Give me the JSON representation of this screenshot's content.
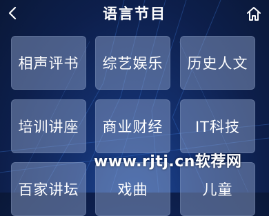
{
  "header": {
    "title": "语言节目",
    "back_icon": "chevron-left-icon",
    "home_icon": "home-icon"
  },
  "tiles": [
    {
      "label": "相声评书"
    },
    {
      "label": "综艺娱乐"
    },
    {
      "label": "历史人文"
    },
    {
      "label": "培训讲座"
    },
    {
      "label": "商业财经"
    },
    {
      "label": "IT科技"
    },
    {
      "label": "百家讲坛"
    },
    {
      "label": "戏曲"
    },
    {
      "label": "儿童"
    }
  ],
  "watermark": "www.rjtj.cn软荐网",
  "colors": {
    "background": "#0d1f4c",
    "tile": "#96aad2",
    "text": "#ffffff"
  }
}
